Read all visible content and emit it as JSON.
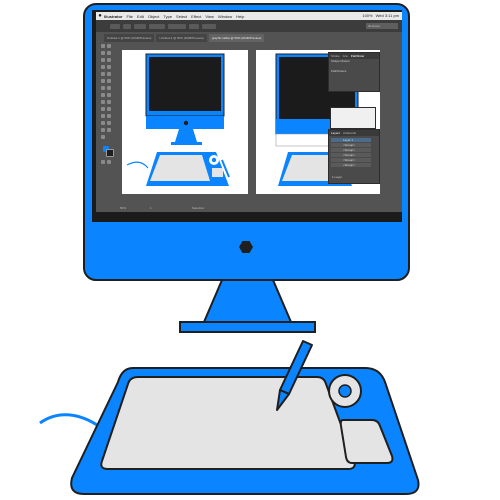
{
  "colors": {
    "accent": "#0a84ff",
    "outline": "#1f1f1f",
    "screen_bezel": "#1b1b1b",
    "app_background": "#535353",
    "artboard": "#ffffff",
    "pad_surface": "#e4e4e4"
  },
  "menubar": {
    "app_name": "Illustrator",
    "menus": [
      "File",
      "Edit",
      "Object",
      "Type",
      "Select",
      "Effect",
      "View",
      "Window",
      "Help"
    ],
    "status_right": [
      "100%",
      "Wed 3:11 pm"
    ]
  },
  "control_bar": {
    "search_placeholder": "Illustrator"
  },
  "tabs": [
    {
      "label": "Untitled-1 @ 50% (RGB/Preview)",
      "active": false
    },
    {
      "label": "Untitled-2 @ 50% (RGB/Preview)",
      "active": false
    },
    {
      "label": "graphic tablet @ 50% (RGB/Preview)",
      "active": true
    }
  ],
  "panels": {
    "swatches_tabs": [
      "Stroke",
      "Gra",
      "Pathfinder"
    ],
    "shape_modes_label": "Shape Modes:",
    "pathfinders_label": "Pathfinders:",
    "layers_tabs": [
      "Layers",
      "Artboards"
    ],
    "layer_names": [
      "Layer 1",
      "<Group>",
      "<Group>",
      "<Group>",
      "<Group>",
      "<Group>"
    ],
    "layers_count": "1 Layer"
  },
  "status_bar": {
    "zoom": "50%",
    "artboard_nav": "1",
    "tool_label": "Selection"
  },
  "hardware": {
    "power_button_icon": "hexagon-icon",
    "stylus_icon": "pen-stylus-icon"
  }
}
